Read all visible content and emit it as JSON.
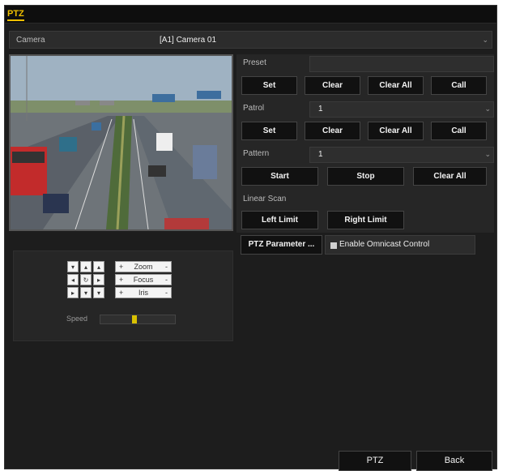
{
  "window": {
    "title": "PTZ"
  },
  "camera": {
    "label": "Camera",
    "value": "[A1] Camera 01"
  },
  "preset": {
    "label": "Preset",
    "value": "",
    "buttons": [
      "Set",
      "Clear",
      "Clear All",
      "Call"
    ]
  },
  "patrol": {
    "label": "Patrol",
    "value": "1",
    "buttons": [
      "Set",
      "Clear",
      "Clear All",
      "Call"
    ]
  },
  "pattern": {
    "label": "Pattern",
    "value": "1",
    "buttons": [
      "Start",
      "Stop",
      "Clear All"
    ]
  },
  "linear_scan": {
    "label": "Linear Scan",
    "buttons": [
      "Left Limit",
      "Right Limit"
    ]
  },
  "ptz_parameter": {
    "label": "PTZ Parameter ..."
  },
  "omnicast": {
    "label": "Enable Omnicast Control",
    "checked": true
  },
  "control": {
    "zoom_label": "Zoom",
    "focus_label": "Focus",
    "iris_label": "Iris",
    "plus": "+",
    "minus": "-",
    "speed_label": "Speed",
    "speed_level": 0.45
  },
  "footer": {
    "ptz_label": "PTZ",
    "back_label": "Back"
  },
  "colors": {
    "accent": "#f0c000",
    "background": "#1d1d1d",
    "button": "#111111"
  }
}
